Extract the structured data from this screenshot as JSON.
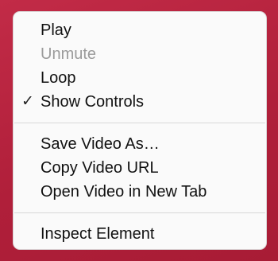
{
  "menu": {
    "items": [
      {
        "label": "Play",
        "enabled": true,
        "checked": false
      },
      {
        "label": "Unmute",
        "enabled": false,
        "checked": false
      },
      {
        "label": "Loop",
        "enabled": true,
        "checked": false
      },
      {
        "label": "Show Controls",
        "enabled": true,
        "checked": true
      },
      {
        "label": "Save Video As…",
        "enabled": true,
        "checked": false
      },
      {
        "label": "Copy Video URL",
        "enabled": true,
        "checked": false
      },
      {
        "label": "Open Video in New Tab",
        "enabled": true,
        "checked": false
      },
      {
        "label": "Inspect Element",
        "enabled": true,
        "checked": false
      }
    ],
    "check_glyph": "✓"
  },
  "colors": {
    "background": "#b8243e",
    "menu_background": "#fafafa",
    "text": "#111111",
    "disabled_text": "#9b9b9b"
  }
}
